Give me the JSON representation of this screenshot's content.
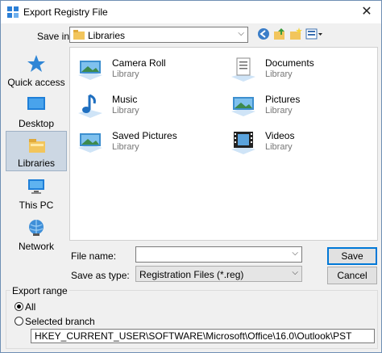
{
  "window": {
    "title": "Export Registry File"
  },
  "save_in": {
    "label": "Save in:",
    "value": "Libraries"
  },
  "places": [
    {
      "label": "Quick access",
      "icon": "star-icon"
    },
    {
      "label": "Desktop",
      "icon": "desktop-icon"
    },
    {
      "label": "Libraries",
      "icon": "libraries-icon",
      "selected": true
    },
    {
      "label": "This PC",
      "icon": "computer-icon"
    },
    {
      "label": "Network",
      "icon": "network-icon"
    }
  ],
  "items": [
    {
      "name": "Camera Roll",
      "sub": "Library",
      "icon": "picture-library-icon"
    },
    {
      "name": "Documents",
      "sub": "Library",
      "icon": "documents-library-icon"
    },
    {
      "name": "Music",
      "sub": "Library",
      "icon": "music-library-icon"
    },
    {
      "name": "Pictures",
      "sub": "Library",
      "icon": "picture-library-icon"
    },
    {
      "name": "Saved Pictures",
      "sub": "Library",
      "icon": "picture-library-icon"
    },
    {
      "name": "Videos",
      "sub": "Library",
      "icon": "videos-library-icon"
    }
  ],
  "file_name": {
    "label": "File name:",
    "value": ""
  },
  "save_as_type": {
    "label": "Save as type:",
    "value": "Registration Files (*.reg)"
  },
  "buttons": {
    "save": "Save",
    "cancel": "Cancel"
  },
  "export_range": {
    "title": "Export range",
    "all_label": "All",
    "all_selected": true,
    "branch_label": "Selected branch",
    "branch_value": "HKEY_CURRENT_USER\\SOFTWARE\\Microsoft\\Office\\16.0\\Outlook\\PST"
  },
  "colors": {
    "accent": "#0078d7",
    "selected_place": "#ccd7e3"
  }
}
